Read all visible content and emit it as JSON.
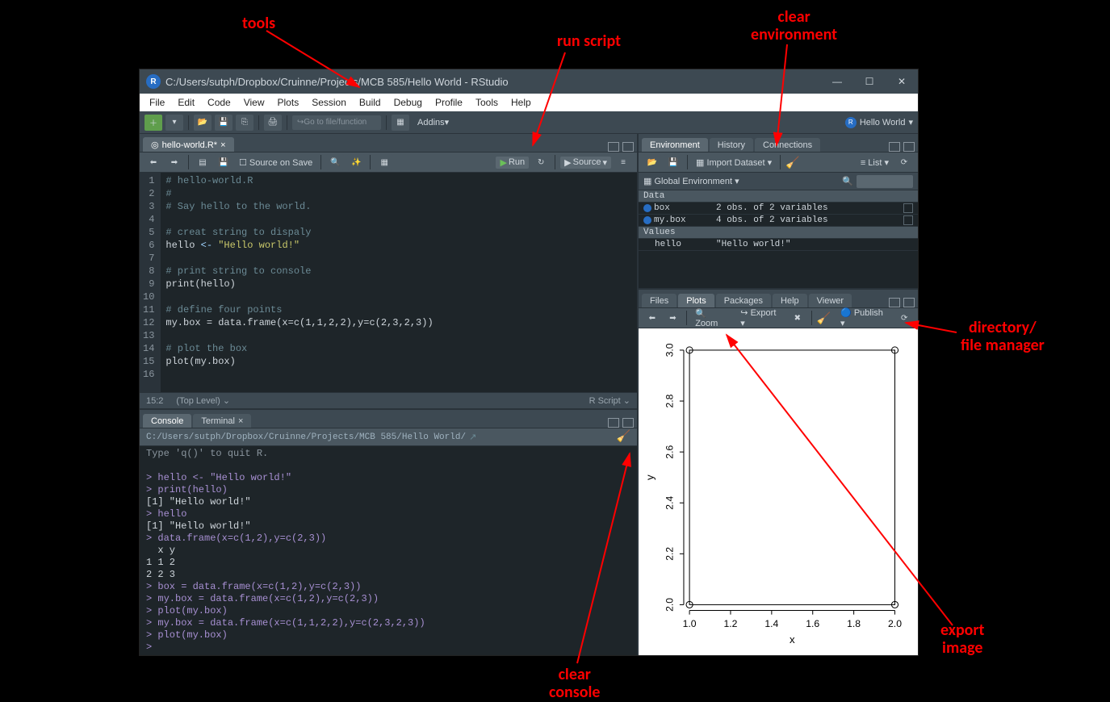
{
  "window": {
    "title": "C:/Users/sutph/Dropbox/Cruinne/Projects/MCB 585/Hello World - RStudio",
    "min": "—",
    "max": "☐",
    "close": "✕"
  },
  "menubar": [
    "File",
    "Edit",
    "Code",
    "View",
    "Plots",
    "Session",
    "Build",
    "Debug",
    "Profile",
    "Tools",
    "Help"
  ],
  "maintoolbar": {
    "gotofile": "Go to file/function",
    "addins": "Addins",
    "project": "Hello World"
  },
  "source": {
    "tab": "hello-world.R*",
    "source_on_save": "Source on Save",
    "run": "Run",
    "source_btn": "Source",
    "status_left": "15:2",
    "status_mid": "(Top Level)",
    "status_right": "R Script",
    "lines": [
      {
        "n": "1",
        "txt": "# hello-world.R",
        "cls": "cm"
      },
      {
        "n": "2",
        "txt": "#",
        "cls": "cm"
      },
      {
        "n": "3",
        "txt": "# Say hello to the world.",
        "cls": "cm"
      },
      {
        "n": "4",
        "txt": "",
        "cls": ""
      },
      {
        "n": "5",
        "txt": "# creat string to dispaly",
        "cls": "cm"
      },
      {
        "n": "6",
        "txt": "hello <- \"Hello world!\"",
        "cls": "str6"
      },
      {
        "n": "7",
        "txt": "",
        "cls": ""
      },
      {
        "n": "8",
        "txt": "# print string to console",
        "cls": "cm"
      },
      {
        "n": "9",
        "txt": "print(hello)",
        "cls": "fn"
      },
      {
        "n": "10",
        "txt": "",
        "cls": ""
      },
      {
        "n": "11",
        "txt": "# define four points",
        "cls": "cm"
      },
      {
        "n": "12",
        "txt": "my.box = data.frame(x=c(1,1,2,2),y=c(2,3,2,3))",
        "cls": "fn"
      },
      {
        "n": "13",
        "txt": "",
        "cls": ""
      },
      {
        "n": "14",
        "txt": "# plot the box",
        "cls": "cm"
      },
      {
        "n": "15",
        "txt": "plot(my.box)",
        "cls": "fn"
      },
      {
        "n": "16",
        "txt": "",
        "cls": ""
      }
    ]
  },
  "console": {
    "tab1": "Console",
    "tab2": "Terminal",
    "path": "C:/Users/sutph/Dropbox/Cruinne/Projects/MCB 585/Hello World/",
    "lines": [
      {
        "t": "Type 'q()' to quit R.",
        "c": "gray"
      },
      {
        "t": "",
        "c": ""
      },
      {
        "t": "> hello <- \"Hello world!\"",
        "c": "pr"
      },
      {
        "t": "> print(hello)",
        "c": "pr"
      },
      {
        "t": "[1] \"Hello world!\"",
        "c": "out"
      },
      {
        "t": "> hello",
        "c": "pr"
      },
      {
        "t": "[1] \"Hello world!\"",
        "c": "out"
      },
      {
        "t": "> data.frame(x=c(1,2),y=c(2,3))",
        "c": "pr"
      },
      {
        "t": "  x y",
        "c": "out"
      },
      {
        "t": "1 1 2",
        "c": "out"
      },
      {
        "t": "2 2 3",
        "c": "out"
      },
      {
        "t": "> box = data.frame(x=c(1,2),y=c(2,3))",
        "c": "pr"
      },
      {
        "t": "> my.box = data.frame(x=c(1,2),y=c(2,3))",
        "c": "pr"
      },
      {
        "t": "> plot(my.box)",
        "c": "pr"
      },
      {
        "t": "> my.box = data.frame(x=c(1,1,2,2),y=c(2,3,2,3))",
        "c": "pr"
      },
      {
        "t": "> plot(my.box)",
        "c": "pr"
      },
      {
        "t": "> ",
        "c": "pr"
      }
    ]
  },
  "env": {
    "tabs": [
      "Environment",
      "History",
      "Connections"
    ],
    "import": "Import Dataset",
    "list": "List",
    "scope": "Global Environment",
    "data_hdr": "Data",
    "values_hdr": "Values",
    "rows_data": [
      {
        "name": "box",
        "val": "2 obs. of 2 variables"
      },
      {
        "name": "my.box",
        "val": "4 obs. of 2 variables"
      }
    ],
    "rows_values": [
      {
        "name": "hello",
        "val": "\"Hello world!\""
      }
    ]
  },
  "plots": {
    "tabs": [
      "Files",
      "Plots",
      "Packages",
      "Help",
      "Viewer"
    ],
    "zoom": "Zoom",
    "export": "Export",
    "publish": "Publish"
  },
  "chart_data": {
    "type": "scatter",
    "x": [
      1,
      1,
      2,
      2
    ],
    "y": [
      2,
      3,
      2,
      3
    ],
    "xlabel": "x",
    "ylabel": "y",
    "xlim": [
      1.0,
      2.0
    ],
    "ylim": [
      2.0,
      3.0
    ],
    "xticks": [
      1.0,
      1.2,
      1.4,
      1.6,
      1.8,
      2.0
    ],
    "yticks": [
      2.0,
      2.2,
      2.4,
      2.6,
      2.8,
      3.0
    ]
  },
  "annotations": {
    "tools": "tools",
    "run_script": "run script",
    "clear_env": "clear\nenvironment",
    "clear_console": "clear\nconsole",
    "dir_mgr": "directory/\nfile manager",
    "export_img": "export\nimage"
  }
}
